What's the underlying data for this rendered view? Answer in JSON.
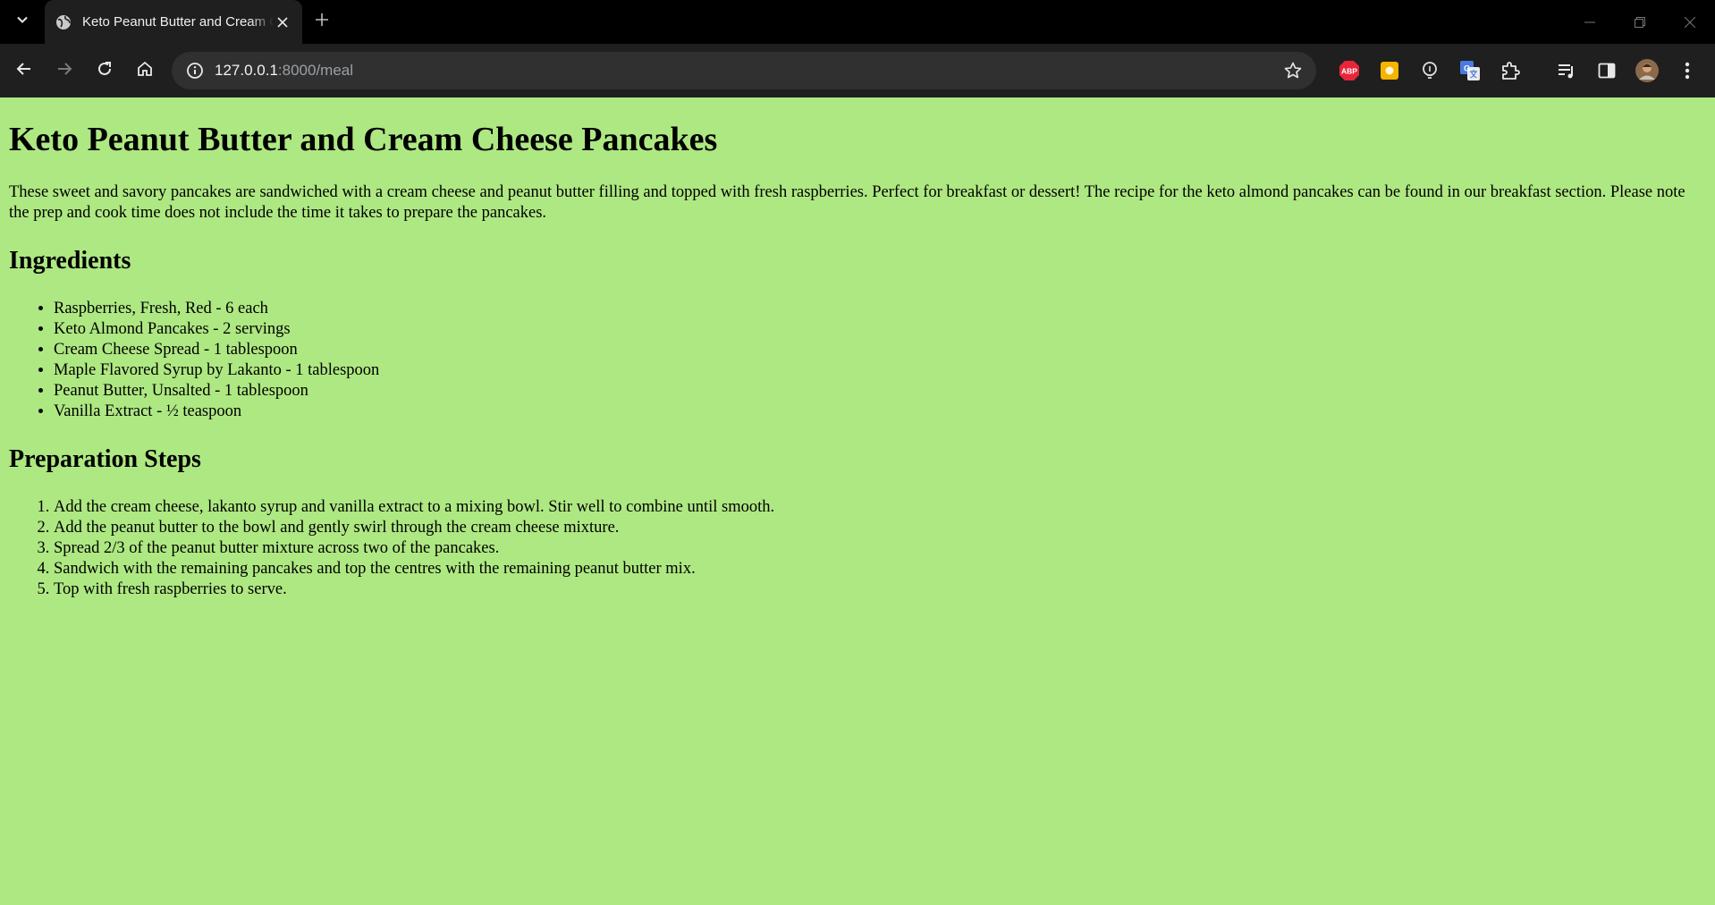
{
  "browser": {
    "tab_title": "Keto Peanut Butter and Cream Cheese Pancakes",
    "url_host": "127.0.0.1",
    "url_path": ":8000/meal",
    "extensions": [
      "adblock-plus-icon",
      "notes-icon",
      "lightbulb-icon",
      "google-translate-icon",
      "extensions-puzzle-icon"
    ],
    "adblock_label": "ABP"
  },
  "page": {
    "title": "Keto Peanut Butter and Cream Cheese Pancakes",
    "description": "These sweet and savory pancakes are sandwiched with a cream cheese and peanut butter filling and topped with fresh raspberries. Perfect for breakfast or dessert! The recipe for the keto almond pancakes can be found in our breakfast section. Please note the prep and cook time does not include the time it takes to prepare the pancakes.",
    "ingredients_heading": "Ingredients",
    "ingredients": [
      "Raspberries, Fresh, Red - 6 each",
      "Keto Almond Pancakes - 2 servings",
      "Cream Cheese Spread - 1 tablespoon",
      "Maple Flavored Syrup by Lakanto - 1 tablespoon",
      "Peanut Butter, Unsalted - 1 tablespoon",
      "Vanilla Extract - ½ teaspoon"
    ],
    "steps_heading": "Preparation Steps",
    "steps": [
      "Add the cream cheese, lakanto syrup and vanilla extract to a mixing bowl. Stir well to combine until smooth.",
      "Add the peanut butter to the bowl and gently swirl through the cream cheese mixture.",
      "Spread 2/3 of the peanut butter mixture across two of the pancakes.",
      "Sandwich with the remaining pancakes and top the centres with the remaining peanut butter mix.",
      "Top with fresh raspberries to serve."
    ]
  },
  "colors": {
    "page_background": "#aee882",
    "chrome_background": "#000000",
    "adblock_red": "#e8263b",
    "notes_yellow": "#f4b400",
    "translate_blue": "#4a7be0"
  }
}
